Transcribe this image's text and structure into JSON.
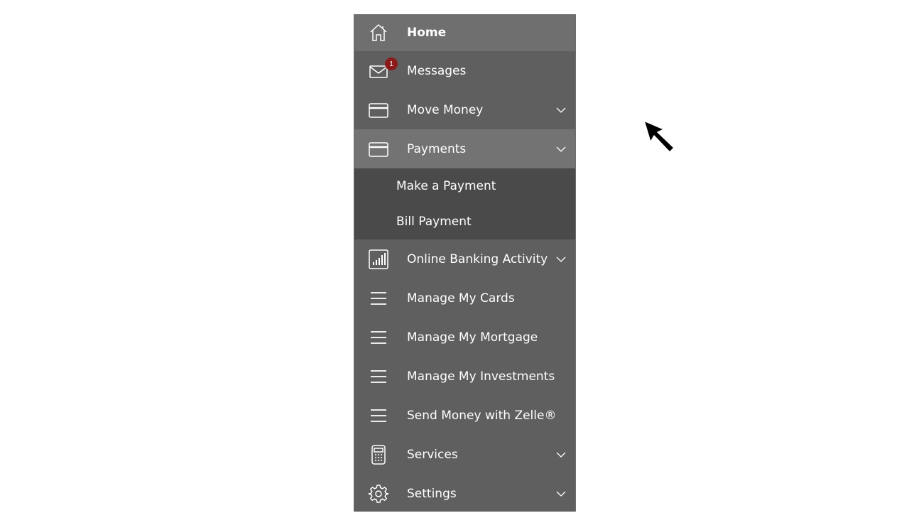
{
  "nav": {
    "home": {
      "label": "Home",
      "icon": "home-icon"
    },
    "messages": {
      "label": "Messages",
      "icon": "mail-icon",
      "badge": "1"
    },
    "move_money": {
      "label": "Move Money",
      "icon": "card-icon"
    },
    "payments": {
      "label": "Payments",
      "icon": "card-icon",
      "sub": [
        "Make a Payment",
        "Bill Payment"
      ]
    },
    "online_banking": {
      "label": "Online Banking Activity",
      "icon": "bar-chart-icon"
    },
    "cards": {
      "label": "Manage My Cards",
      "icon": "menu-icon"
    },
    "mortgage": {
      "label": "Manage My Mortgage",
      "icon": "menu-icon"
    },
    "investments": {
      "label": "Manage My Investments",
      "icon": "menu-icon"
    },
    "zelle": {
      "label": "Send Money with Zelle®",
      "icon": "menu-icon"
    },
    "services": {
      "label": "Services",
      "icon": "calculator-icon"
    },
    "settings": {
      "label": "Settings",
      "icon": "gear-icon"
    }
  },
  "colors": {
    "nav_bg": "#5f5f5f",
    "home_bg": "#6f6f6f",
    "active_bg": "#737373",
    "submenu_bg": "#4a4a4a",
    "badge": "#8b1a1a"
  }
}
